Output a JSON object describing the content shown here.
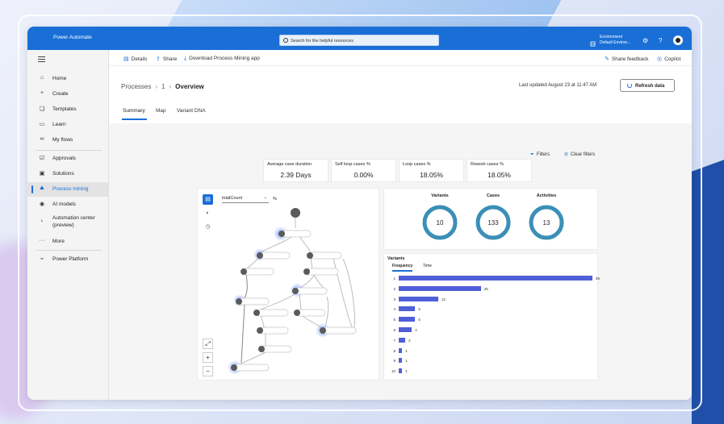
{
  "topbar": {
    "app_title": "Power Automate",
    "search_placeholder": "Search for the helpful resources",
    "env_label": "Environment",
    "env_value": "Default Environ..."
  },
  "sidebar": {
    "items": [
      {
        "label": "Home",
        "icon": "home-icon"
      },
      {
        "label": "Create",
        "icon": "plus-icon"
      },
      {
        "label": "Templates",
        "icon": "templates-icon"
      },
      {
        "label": "Learn",
        "icon": "book-icon"
      },
      {
        "label": "My flows",
        "icon": "flows-icon"
      },
      {
        "label": "Approvals",
        "icon": "approvals-icon"
      },
      {
        "label": "Solutions",
        "icon": "solutions-icon"
      },
      {
        "label": "Process mining",
        "icon": "process-mining-icon",
        "active": true
      },
      {
        "label": "AI models",
        "icon": "ai-models-icon"
      },
      {
        "label": "Automation center (preview)",
        "icon": "automation-center-icon"
      },
      {
        "label": "More",
        "icon": "more-icon"
      },
      {
        "label": "Power Platform",
        "icon": "power-platform-icon"
      }
    ]
  },
  "cmdbar": {
    "details": "Details",
    "share": "Share",
    "download": "Download Process Mining app",
    "share_feedback": "Share feedback",
    "copilot": "Copilot"
  },
  "header": {
    "breadcrumb": [
      "Processes",
      "1",
      "Overview"
    ],
    "last_updated": "Last updated August 23 at 11:47 AM",
    "refresh": "Refresh data"
  },
  "tabs": [
    "Summary",
    "Map",
    "Variant DNA"
  ],
  "filters": {
    "filters": "Filters",
    "clear": "Clear filters"
  },
  "kpis": [
    {
      "title": "Average case duration",
      "value": "2.39 Days"
    },
    {
      "title": "Self loop cases %",
      "value": "0.00%"
    },
    {
      "title": "Loop cases %",
      "value": "18.05%"
    },
    {
      "title": "Rework cases %",
      "value": "18.05%"
    }
  ],
  "process_map": {
    "metric": "totalCount",
    "percent_symbol": "%",
    "zoom_fit": "⤢",
    "zoom_in": "+",
    "zoom_out": "−"
  },
  "stats": [
    {
      "label": "Variants",
      "value": "10"
    },
    {
      "label": "Cases",
      "value": "133"
    },
    {
      "label": "Activities",
      "value": "13"
    }
  ],
  "variants": {
    "title": "Variants",
    "tab_frequency": "Frequency",
    "tab_time": "Time",
    "bars": [
      {
        "n": "1",
        "value": 59
      },
      {
        "n": "2",
        "value": 25
      },
      {
        "n": "3",
        "value": 12
      },
      {
        "n": "4",
        "value": 5
      },
      {
        "n": "5",
        "value": 5
      },
      {
        "n": "6",
        "value": 4
      },
      {
        "n": "7",
        "value": 2
      },
      {
        "n": "8",
        "value": 1
      },
      {
        "n": "9",
        "value": 1
      },
      {
        "n": "10",
        "value": 1
      }
    ]
  },
  "colors": {
    "accent": "#1a6fd6",
    "bar": "#4f5fd8",
    "donut": "#3a8fb7"
  }
}
